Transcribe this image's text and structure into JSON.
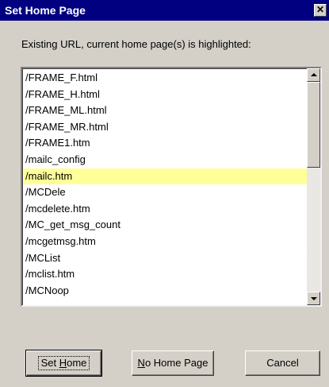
{
  "window": {
    "title": "Set Home Page",
    "close_symbol": "✕"
  },
  "prompt": "Existing URL, current home page(s) is highlighted:",
  "list": {
    "items": [
      {
        "label": "/FRAME_F.html",
        "selected": false
      },
      {
        "label": "/FRAME_H.html",
        "selected": false
      },
      {
        "label": "/FRAME_ML.html",
        "selected": false
      },
      {
        "label": "/FRAME_MR.html",
        "selected": false
      },
      {
        "label": "/FRAME1.htm",
        "selected": false
      },
      {
        "label": "/mailc_config",
        "selected": false
      },
      {
        "label": "/mailc.htm",
        "selected": true
      },
      {
        "label": "/MCDele",
        "selected": false
      },
      {
        "label": "/mcdelete.htm",
        "selected": false
      },
      {
        "label": "/MC_get_msg_count",
        "selected": false
      },
      {
        "label": "/mcgetmsg.htm",
        "selected": false
      },
      {
        "label": "/MCList",
        "selected": false
      },
      {
        "label": "/mclist.htm",
        "selected": false
      },
      {
        "label": "/MCNoop",
        "selected": false
      }
    ],
    "highlight_color": "#ffff99"
  },
  "buttons": {
    "set_home": {
      "pre": "Set ",
      "key": "H",
      "post": "ome"
    },
    "no_home": {
      "pre": "",
      "key": "N",
      "post": "o Home Page"
    },
    "cancel": "Cancel"
  }
}
